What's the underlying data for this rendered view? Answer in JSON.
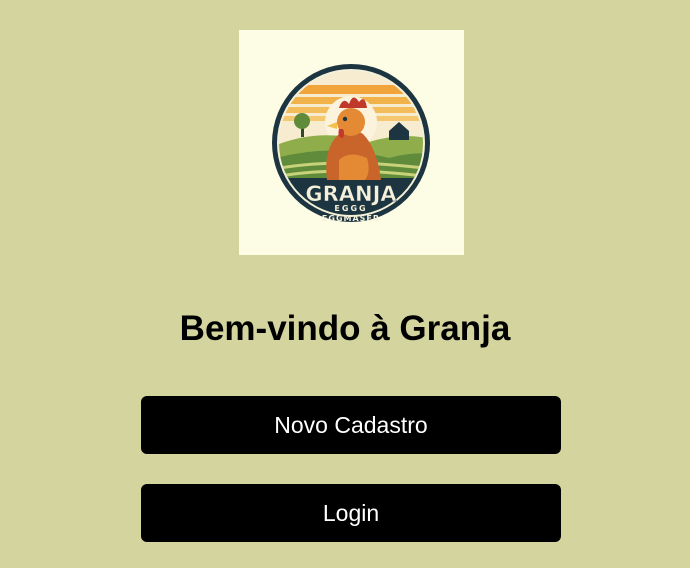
{
  "logo": {
    "brand_text": "GRANJA",
    "sub_text_1": "EGGG",
    "sub_text_2": "EGGMASER"
  },
  "page": {
    "title": "Bem-vindo à Granja"
  },
  "actions": {
    "register_label": "Novo Cadastro",
    "login_label": "Login"
  },
  "colors": {
    "background": "#d4d49e",
    "button_bg": "#000000",
    "button_text": "#ffffff",
    "logo_panel": "#fdfde6"
  }
}
